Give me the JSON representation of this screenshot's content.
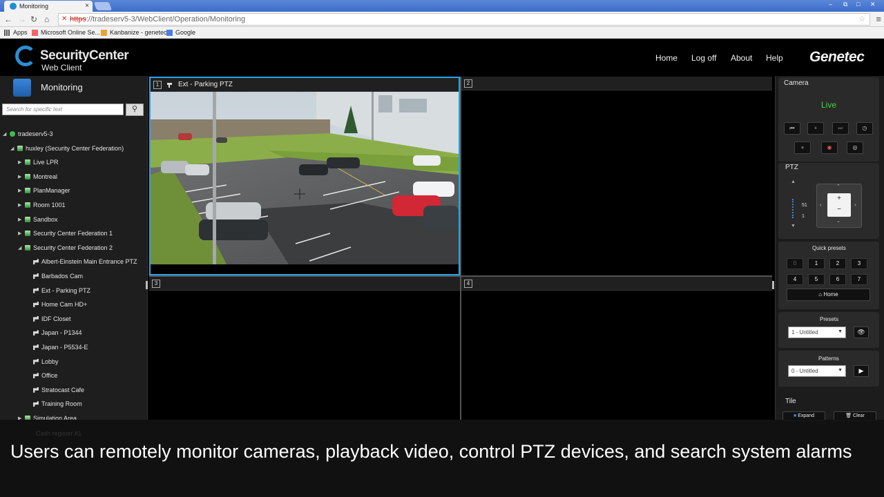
{
  "browser": {
    "tab_title": "Monitoring",
    "url_scheme": "https",
    "url_rest": "://tradeserv5-3/WebClient/Operation/Monitoring",
    "bookmarks": [
      "Apps",
      "Microsoft Online Se...",
      "Kanbanize - genetec",
      "Google"
    ]
  },
  "header": {
    "product_title": "SecurityCenter",
    "product_subtitle": "Web Client",
    "nav": [
      "Home",
      "Log off",
      "About",
      "Help"
    ],
    "brand": "Genetec"
  },
  "left_panel": {
    "title": "Monitoring",
    "search_placeholder": "Search for specific text",
    "tree": [
      {
        "label": "tradeserv5-3",
        "level": 0,
        "arrow": "expanded",
        "icon": "server-icon"
      },
      {
        "label": "huxley (Security Center Federation)",
        "level": 1,
        "arrow": "expanded",
        "icon": "federation-icon"
      },
      {
        "label": "Live LPR",
        "level": 2,
        "arrow": "collapsed",
        "icon": "area-icon"
      },
      {
        "label": "Montreal",
        "level": 2,
        "arrow": "collapsed",
        "icon": "area-icon"
      },
      {
        "label": "PlanManager",
        "level": 2,
        "arrow": "collapsed",
        "icon": "area-icon"
      },
      {
        "label": "Room 1001",
        "level": 2,
        "arrow": "collapsed",
        "icon": "area-icon"
      },
      {
        "label": "Sandbox",
        "level": 2,
        "arrow": "collapsed",
        "icon": "area-icon"
      },
      {
        "label": "Security Center Federation 1",
        "level": 2,
        "arrow": "collapsed",
        "icon": "federation-icon"
      },
      {
        "label": "Security Center Federation 2",
        "level": 2,
        "arrow": "expanded",
        "icon": "federation-icon"
      },
      {
        "label": "Albert-Einstein Main Entrance PTZ",
        "level": 3,
        "arrow": "none",
        "icon": "camera-icon"
      },
      {
        "label": "Barbados Cam",
        "level": 3,
        "arrow": "none",
        "icon": "camera-icon"
      },
      {
        "label": "Ext - Parking PTZ",
        "level": 3,
        "arrow": "none",
        "icon": "camera-icon"
      },
      {
        "label": "Home Cam HD+",
        "level": 3,
        "arrow": "none",
        "icon": "camera-icon"
      },
      {
        "label": "IDF Closet",
        "level": 3,
        "arrow": "none",
        "icon": "camera-icon"
      },
      {
        "label": "Japan - P1344",
        "level": 3,
        "arrow": "none",
        "icon": "camera-icon"
      },
      {
        "label": "Japan - P5534-E",
        "level": 3,
        "arrow": "none",
        "icon": "camera-icon"
      },
      {
        "label": "Lobby",
        "level": 3,
        "arrow": "none",
        "icon": "camera-icon"
      },
      {
        "label": "Office",
        "level": 3,
        "arrow": "none",
        "icon": "camera-icon"
      },
      {
        "label": "Stratocast Cafe",
        "level": 3,
        "arrow": "none",
        "icon": "camera-icon"
      },
      {
        "label": "Training Room",
        "level": 3,
        "arrow": "none",
        "icon": "camera-icon"
      },
      {
        "label": "Simulation Area",
        "level": 2,
        "arrow": "collapsed",
        "icon": "area-icon"
      }
    ]
  },
  "tiles": [
    {
      "number": "1",
      "title": "Ext - Parking PTZ"
    },
    {
      "number": "2",
      "title": ""
    },
    {
      "number": "3",
      "title": ""
    },
    {
      "number": "4",
      "title": ""
    }
  ],
  "right_panel": {
    "camera_label": "Camera",
    "status": "Live",
    "ptz_label": "PTZ",
    "zoom_value": "51",
    "speed_value": "1",
    "quick_presets_label": "Quick presets",
    "quick_presets": [
      "0",
      "1",
      "2",
      "3",
      "4",
      "5",
      "6",
      "7"
    ],
    "home_label": "Home",
    "presets_label": "Presets",
    "preset_selected": "1 - Untitled",
    "patterns_label": "Patterns",
    "pattern_selected": "0 - Untitled",
    "tile_label": "Tile",
    "expand_label": "Expand",
    "clear_label": "Clear"
  },
  "caption": {
    "text": "Users can remotely monitor cameras, playback video, control PTZ devices, and search system alarms",
    "hidden_tree_item": "Cash register #1"
  },
  "colors": {
    "accent_blue": "#2aa5e8",
    "live_green": "#3bdc3b"
  }
}
